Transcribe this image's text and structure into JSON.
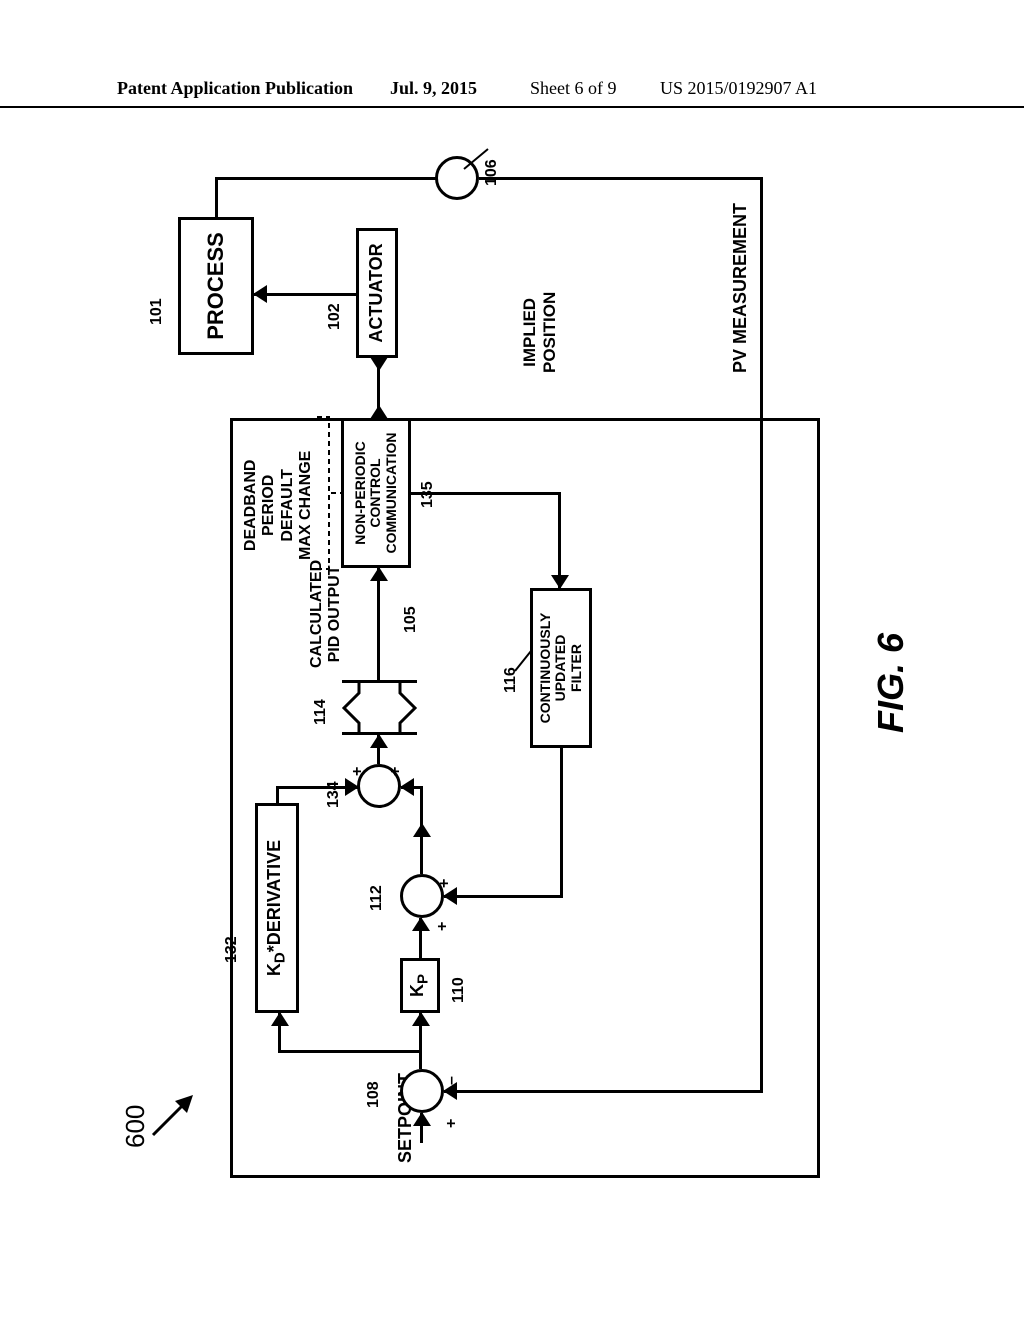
{
  "header": {
    "left": "Patent Application Publication",
    "date": "Jul. 9, 2015",
    "sheet": "Sheet 6 of 9",
    "pubno": "US 2015/0192907 A1"
  },
  "labels": {
    "setpoint": "SETPOINT",
    "derivative_html": "K<sub>D</sub>*DERIVATIVE",
    "kp_html": "K<sub>P</sub>",
    "calc": "CALCULATED\nPID OUTPUT",
    "nonperiodic": "NON-PERIODIC\nCONTROL\nCOMMUNICATION",
    "params": "DEADBAND\nPERIOD\nDEFAULT\nMAX CHANGE",
    "cuf": "CONTINUOUSLY\nUPDATED\nFILTER",
    "actuator": "ACTUATOR",
    "process": "PROCESS",
    "implied": "IMPLIED\nPOSITION",
    "pvmeas": "PV MEASUREMENT",
    "figlabel": "FIG. 6",
    "n600": "600"
  },
  "refs": {
    "r101": "101",
    "r102": "102",
    "r105": "105",
    "r106": "106",
    "r108": "108",
    "r110": "110",
    "r112": "112",
    "r114": "114",
    "r116": "116",
    "r132": "132",
    "r134": "134",
    "r135": "135"
  },
  "signs": {
    "plus": "+",
    "minus": "–"
  },
  "chart_data": {
    "type": "block-diagram",
    "title": "FIG. 6",
    "ref": "600",
    "nodes": [
      {
        "id": "setpoint",
        "type": "input",
        "label": "SETPOINT"
      },
      {
        "id": "108",
        "type": "sum",
        "ref": "108",
        "signs": [
          "+",
          "-"
        ]
      },
      {
        "id": "110",
        "type": "gain",
        "ref": "110",
        "label": "K_P"
      },
      {
        "id": "132",
        "type": "gain",
        "ref": "132",
        "label": "K_D*DERIVATIVE"
      },
      {
        "id": "112",
        "type": "sum",
        "ref": "112",
        "signs": [
          "+",
          "+"
        ]
      },
      {
        "id": "134",
        "type": "sum",
        "ref": "134",
        "signs": [
          "+",
          "+"
        ]
      },
      {
        "id": "114",
        "type": "limit",
        "ref": "114",
        "label": "high/low limiter"
      },
      {
        "id": "135",
        "type": "block",
        "ref": "135",
        "label": "NON-PERIODIC CONTROL COMMUNICATION",
        "params": [
          "DEADBAND",
          "PERIOD",
          "DEFAULT",
          "MAX CHANGE"
        ]
      },
      {
        "id": "116",
        "type": "block",
        "ref": "116",
        "label": "CONTINUOUSLY UPDATED FILTER"
      },
      {
        "id": "102",
        "type": "block",
        "ref": "102",
        "label": "ACTUATOR"
      },
      {
        "id": "101",
        "type": "block",
        "ref": "101",
        "label": "PROCESS"
      },
      {
        "id": "106",
        "type": "sensor",
        "ref": "106"
      },
      {
        "id": "105",
        "type": "signal",
        "ref": "105",
        "label": "CALCULATED PID OUTPUT"
      }
    ],
    "edges": [
      {
        "from": "setpoint",
        "to": "108"
      },
      {
        "from": "108",
        "to": "110"
      },
      {
        "from": "108",
        "to": "132"
      },
      {
        "from": "110",
        "to": "112",
        "sign": "+"
      },
      {
        "from": "116",
        "to": "112",
        "sign": "+"
      },
      {
        "from": "132",
        "to": "134",
        "sign": "+"
      },
      {
        "from": "112",
        "to": "134",
        "sign": "+"
      },
      {
        "from": "134",
        "to": "114"
      },
      {
        "from": "114",
        "to": "135",
        "label": "CALCULATED PID OUTPUT",
        "ref": "105"
      },
      {
        "from": "135",
        "to": "102"
      },
      {
        "from": "102",
        "to": "101"
      },
      {
        "from": "102",
        "to": "135",
        "label": "IMPLIED POSITION"
      },
      {
        "from": "135",
        "to": "116",
        "label": "IMPLIED POSITION"
      },
      {
        "from": "101",
        "to": "106"
      },
      {
        "from": "106",
        "to": "108",
        "label": "PV MEASUREMENT",
        "sign": "-"
      }
    ]
  }
}
